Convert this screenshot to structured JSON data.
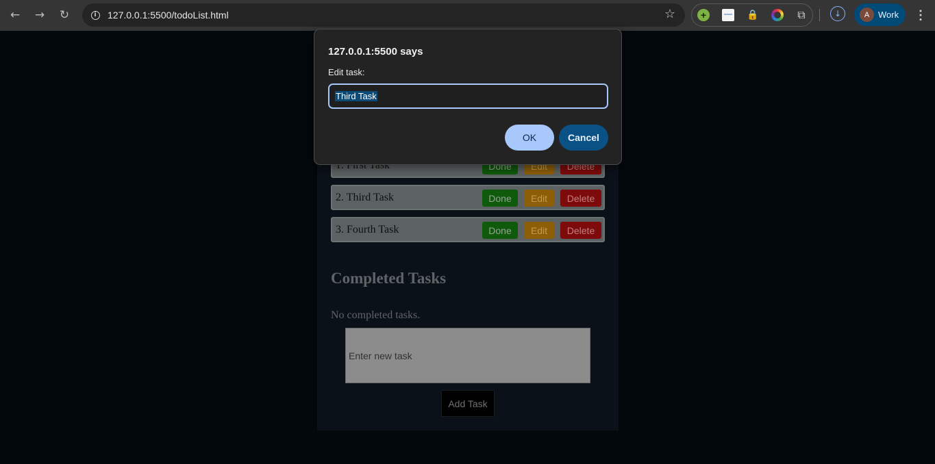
{
  "browser": {
    "back_icon": "←",
    "forward_icon": "→",
    "reload_icon": "↻",
    "url": "127.0.0.1:5500/todoList.html",
    "site_info_icon": "i",
    "star_icon": "☆",
    "extensions": [
      "green-plus-icon",
      "white-doc-icon",
      "lock-icon",
      "color-ring-icon",
      "puzzle-icon"
    ],
    "download_icon": "↓",
    "profile_initial": "A",
    "profile_name": "Work",
    "menu_icon": "⋮"
  },
  "tasks": [
    {
      "label": "1. First Task"
    },
    {
      "label": "2. Third Task"
    },
    {
      "label": "3. Fourth Task"
    }
  ],
  "task_buttons": {
    "done": "Done",
    "edit": "Edit",
    "delete": "Delete"
  },
  "completed": {
    "heading": "Completed Tasks",
    "empty_text": "No completed tasks."
  },
  "new_task": {
    "placeholder": "Enter new task",
    "add_label": "Add Task"
  },
  "dialog": {
    "title": "127.0.0.1:5500 says",
    "label": "Edit task:",
    "value": "Third Task",
    "ok": "OK",
    "cancel": "Cancel"
  },
  "colors": {
    "done": "#0f5b0b",
    "edit": "#8c5e07",
    "delete": "#7e0b0b",
    "accent": "#a8c7fa"
  }
}
